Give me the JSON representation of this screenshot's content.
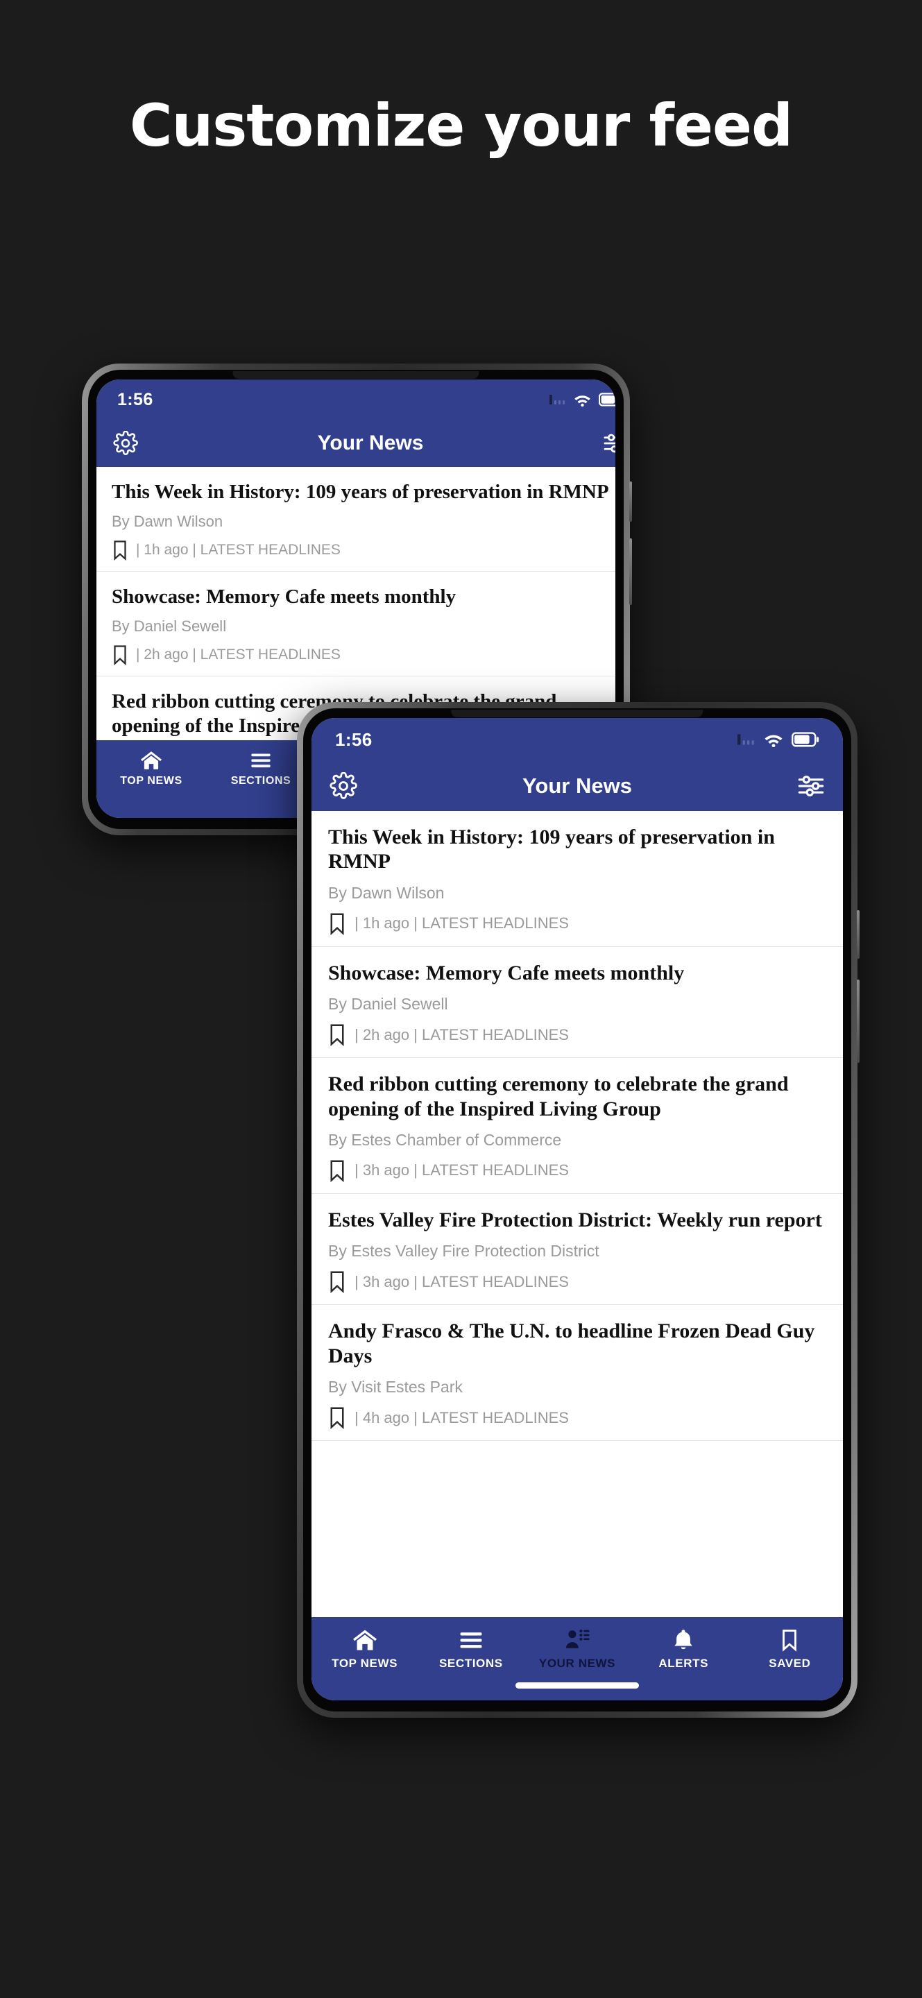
{
  "page": {
    "title": "Customize your feed",
    "background_color": "#1c1c1c",
    "title_color": "#ffffff"
  },
  "theme": {
    "brand_blue": "#313f8d",
    "active_nav_color": "#10143a",
    "byline_gray": "#9a9a9a",
    "divider": "#e3e3e3"
  },
  "app": {
    "status": {
      "time": "1:56",
      "signal_icon": "cellular-signal-icon",
      "wifi_icon": "wifi-icon",
      "battery_icon": "battery-icon"
    },
    "appbar": {
      "settings_icon": "gear-icon",
      "title": "Your News",
      "filter_icon": "tune-sliders-icon"
    },
    "articles": [
      {
        "title": "This Week in History: 109 years of preservation in RMNP",
        "byline": "By Dawn Wilson",
        "bookmark_icon": "bookmark-icon",
        "meta": "| 1h ago | LATEST HEADLINES",
        "time_ago": "1h ago",
        "section": "LATEST HEADLINES"
      },
      {
        "title": "Showcase: Memory Cafe meets monthly",
        "byline": "By Daniel Sewell",
        "bookmark_icon": "bookmark-icon",
        "meta": "| 2h ago | LATEST HEADLINES",
        "time_ago": "2h ago",
        "section": "LATEST HEADLINES"
      },
      {
        "title": "Red ribbon cutting ceremony to celebrate the grand opening of the Inspired Living Group",
        "byline": "By Estes Chamber of Commerce",
        "bookmark_icon": "bookmark-icon",
        "meta": "| 3h ago | LATEST HEADLINES",
        "time_ago": "3h ago",
        "section": "LATEST HEADLINES"
      },
      {
        "title": "Estes Valley Fire Protection District: Weekly run report",
        "byline": "By Estes Valley Fire Protection District",
        "bookmark_icon": "bookmark-icon",
        "meta": "| 3h ago | LATEST HEADLINES",
        "time_ago": "3h ago",
        "section": "LATEST HEADLINES"
      },
      {
        "title": "Andy Frasco & The U.N. to headline Frozen Dead Guy Days",
        "byline": "By Visit Estes Park",
        "bookmark_icon": "bookmark-icon",
        "meta": "| 4h ago | LATEST HEADLINES",
        "time_ago": "4h ago",
        "section": "LATEST HEADLINES"
      }
    ],
    "bottom_nav": [
      {
        "label": "TOP NEWS",
        "icon": "home-icon",
        "active": false
      },
      {
        "label": "SECTIONS",
        "icon": "hamburger-icon",
        "active": false
      },
      {
        "label": "YOUR NEWS",
        "icon": "person-list-icon",
        "active": true
      },
      {
        "label": "ALERTS",
        "icon": "bell-icon",
        "active": false
      },
      {
        "label": "SAVED",
        "icon": "bookmark-icon",
        "active": false
      }
    ]
  }
}
